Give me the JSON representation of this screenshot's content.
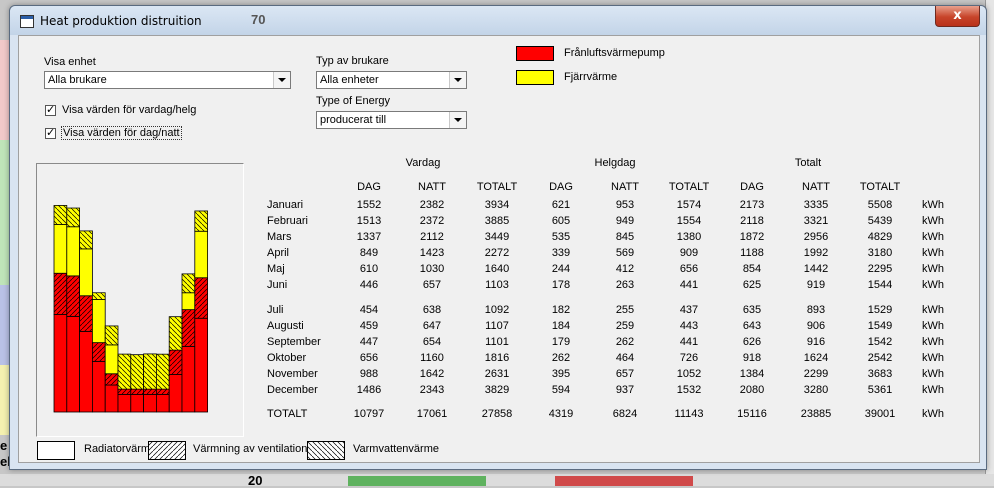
{
  "background": {
    "num_top": "70",
    "num_bottom": "20",
    "letters": [
      "e",
      "el"
    ]
  },
  "window": {
    "title": "Heat produktion distruition",
    "close": "x"
  },
  "controls": {
    "visa_enhet_label": "Visa enhet",
    "visa_enhet_value": "Alla brukare",
    "typ_brukare_label": "Typ av brukare",
    "typ_brukare_value": "Alla enheter",
    "type_energy_label": "Type of Energy",
    "type_energy_value": "producerat till",
    "cb_vardag_helg": "Visa värden för vardag/helg",
    "cb_dag_natt": "Visa värden för dag/natt"
  },
  "legend_top": [
    {
      "label": "Frånluftsvärmepump",
      "color": "#ff0000"
    },
    {
      "label": "Fjärrvärme",
      "color": "#ffff00"
    }
  ],
  "legend_bottom": [
    {
      "label": "Radiatorvärme",
      "pattern": "none"
    },
    {
      "label": "Värmning av ventilation",
      "pattern": "hatch-right"
    },
    {
      "label": "Varmvattenvärme",
      "pattern": "hatch-left"
    }
  ],
  "table": {
    "groups": [
      "Vardag",
      "Helgdag",
      "Totalt"
    ],
    "subheaders": [
      "DAG",
      "NATT",
      "TOTALT",
      "DAG",
      "NATT",
      "TOTALT",
      "DAG",
      "NATT",
      "TOTALT"
    ],
    "unit": "kWh",
    "rows": [
      {
        "month": "Januari",
        "values": [
          "1552",
          "2382",
          "3934",
          "621",
          "953",
          "1574",
          "2173",
          "3335",
          "5508"
        ]
      },
      {
        "month": "Februari",
        "values": [
          "1513",
          "2372",
          "3885",
          "605",
          "949",
          "1554",
          "2118",
          "3321",
          "5439"
        ]
      },
      {
        "month": "Mars",
        "values": [
          "1337",
          "2112",
          "3449",
          "535",
          "845",
          "1380",
          "1872",
          "2956",
          "4829"
        ]
      },
      {
        "month": "April",
        "values": [
          "849",
          "1423",
          "2272",
          "339",
          "569",
          "909",
          "1188",
          "1992",
          "3180"
        ]
      },
      {
        "month": "Maj",
        "values": [
          "610",
          "1030",
          "1640",
          "244",
          "412",
          "656",
          "854",
          "1442",
          "2295"
        ]
      },
      {
        "month": "Juni",
        "values": [
          "446",
          "657",
          "1103",
          "178",
          "263",
          "441",
          "625",
          "919",
          "1544"
        ]
      },
      {
        "month": "Juli",
        "values": [
          "454",
          "638",
          "1092",
          "182",
          "255",
          "437",
          "635",
          "893",
          "1529"
        ]
      },
      {
        "month": "Augusti",
        "values": [
          "459",
          "647",
          "1107",
          "184",
          "259",
          "443",
          "643",
          "906",
          "1549"
        ]
      },
      {
        "month": "September",
        "values": [
          "447",
          "654",
          "1101",
          "179",
          "262",
          "441",
          "626",
          "916",
          "1542"
        ]
      },
      {
        "month": "Oktober",
        "values": [
          "656",
          "1160",
          "1816",
          "262",
          "464",
          "726",
          "918",
          "1624",
          "2542"
        ]
      },
      {
        "month": "November",
        "values": [
          "988",
          "1642",
          "2631",
          "395",
          "657",
          "1052",
          "1384",
          "2299",
          "3683"
        ]
      },
      {
        "month": "December",
        "values": [
          "1486",
          "2343",
          "3829",
          "594",
          "937",
          "1532",
          "2080",
          "3280",
          "5361"
        ]
      }
    ],
    "total": {
      "month": "TOTALT",
      "values": [
        "10797",
        "17061",
        "27858",
        "4319",
        "6824",
        "11143",
        "15116",
        "23885",
        "39001"
      ]
    }
  },
  "chart_data": {
    "type": "bar",
    "categories": [
      "Januari",
      "Februari",
      "Mars",
      "April",
      "Maj",
      "Juni",
      "Juli",
      "Augusti",
      "September",
      "Oktober",
      "November",
      "December"
    ],
    "series": [
      {
        "name": "Radiatorvärme",
        "color": "#ff0000",
        "values": [
          2600,
          2550,
          2150,
          1350,
          720,
          470,
          470,
          470,
          470,
          1000,
          1750,
          2500
        ]
      },
      {
        "name": "Värmning av ventilation",
        "color": "#ff0000",
        "values": [
          1100,
          1080,
          950,
          500,
          300,
          140,
          140,
          140,
          140,
          650,
          980,
          1080
        ]
      },
      {
        "name": "Fjärrvärme",
        "color": "#ffff00",
        "values": [
          1300,
          1310,
          1250,
          1150,
          770,
          0,
          0,
          0,
          0,
          0,
          450,
          1240
        ]
      },
      {
        "name": "Varmvattenvärme",
        "color": "#ffff00",
        "values": [
          508,
          499,
          479,
          180,
          505,
          934,
          919,
          939,
          932,
          892,
          503,
          541
        ]
      }
    ],
    "ylim": [
      0,
      6000
    ]
  }
}
